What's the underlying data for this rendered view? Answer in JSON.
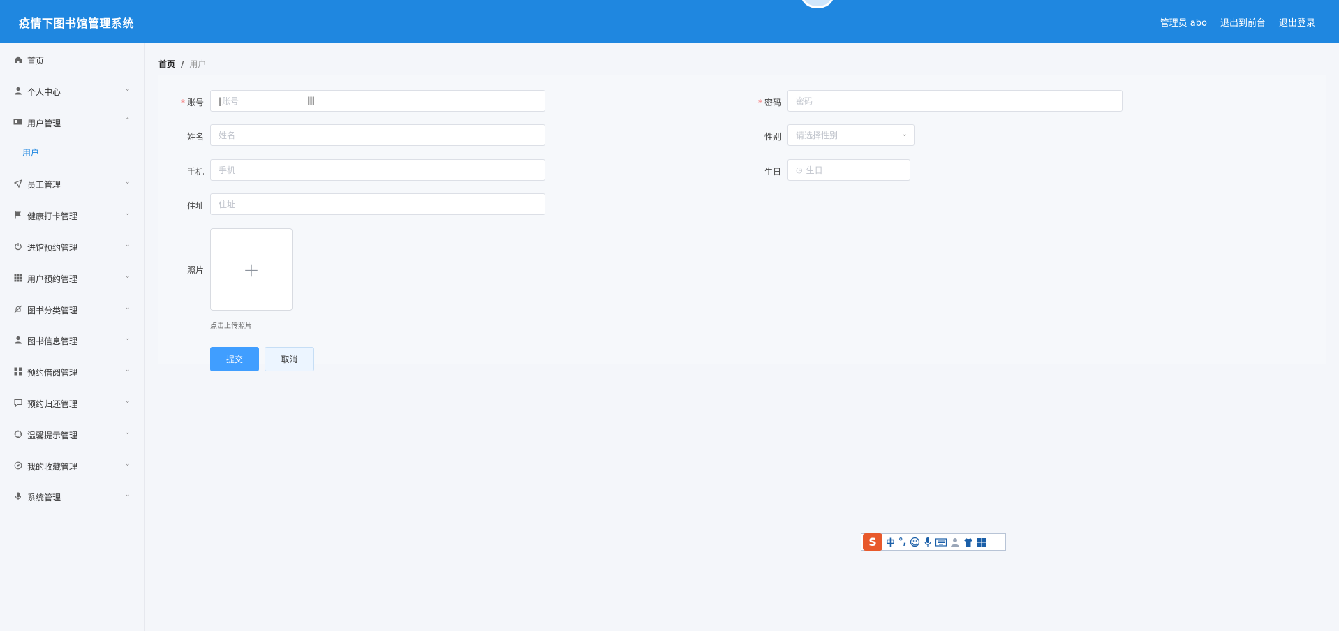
{
  "header": {
    "title": "疫情下图书馆管理系统",
    "admin_label": "管理员 abo",
    "back_front": "退出到前台",
    "logout": "退出登录"
  },
  "sidebar": {
    "items": [
      {
        "label": "首页",
        "icon": "home-icon"
      },
      {
        "label": "个人中心",
        "icon": "user-icon"
      },
      {
        "label": "用户管理",
        "icon": "id-card-icon"
      },
      {
        "label": "员工管理",
        "icon": "send-icon"
      },
      {
        "label": "健康打卡管理",
        "icon": "flag-icon"
      },
      {
        "label": "进馆预约管理",
        "icon": "power-icon"
      },
      {
        "label": "用户预约管理",
        "icon": "grid-icon"
      },
      {
        "label": "图书分类管理",
        "icon": "bell-off-icon"
      },
      {
        "label": "图书信息管理",
        "icon": "person-icon"
      },
      {
        "label": "预约借阅管理",
        "icon": "apps-icon"
      },
      {
        "label": "预约归还管理",
        "icon": "chat-icon"
      },
      {
        "label": "温馨提示管理",
        "icon": "aim-icon"
      },
      {
        "label": "我的收藏管理",
        "icon": "compass-icon"
      },
      {
        "label": "系统管理",
        "icon": "microphone-icon"
      }
    ],
    "sub_item": "用户"
  },
  "breadcrumb": {
    "home": "首页",
    "separator": "/",
    "current": "用户"
  },
  "form": {
    "account": {
      "label": "账号",
      "placeholder": "账号"
    },
    "password": {
      "label": "密码",
      "placeholder": "密码"
    },
    "name": {
      "label": "姓名",
      "placeholder": "姓名"
    },
    "gender": {
      "label": "性别",
      "placeholder": "请选择性别"
    },
    "phone": {
      "label": "手机",
      "placeholder": "手机"
    },
    "birthday": {
      "label": "生日",
      "placeholder": "生日"
    },
    "address": {
      "label": "住址",
      "placeholder": "住址"
    },
    "photo": {
      "label": "照片",
      "tip": "点击上传照片"
    },
    "submit": "提交",
    "cancel": "取消",
    "required_mark": "*"
  },
  "ime_toolbar": {
    "logo": "S",
    "mode": "中",
    "punct": "°,",
    "items": [
      "emoji-icon",
      "microphone-icon",
      "keyboard-icon",
      "user-icon",
      "skin-icon",
      "toolbox-icon"
    ]
  },
  "colors": {
    "primary": "#1f87e0",
    "button": "#409eff",
    "required": "#f56c6c"
  }
}
